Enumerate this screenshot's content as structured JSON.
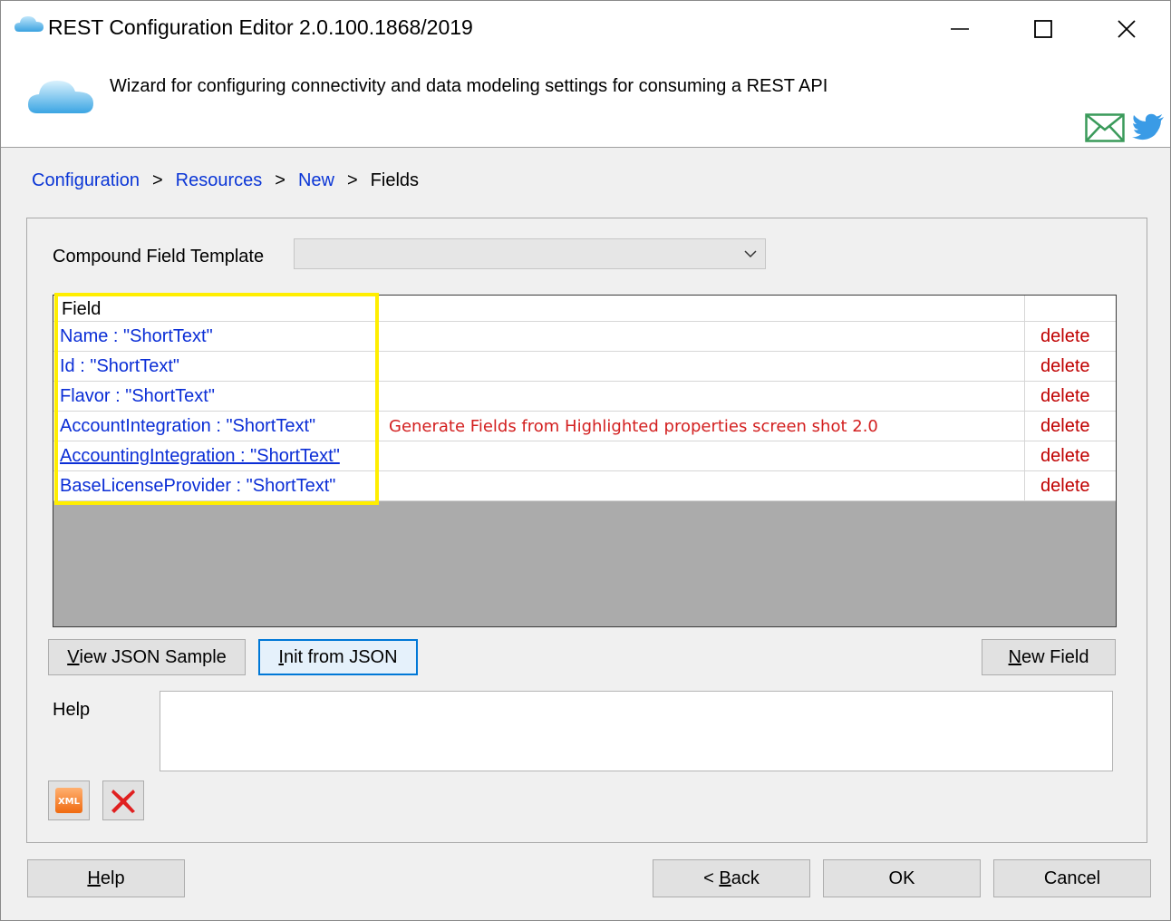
{
  "window": {
    "title": "REST Configuration Editor 2.0.100.1868/2019"
  },
  "header": {
    "description": "Wizard for configuring connectivity and data modeling settings for consuming a REST API"
  },
  "breadcrumb": {
    "items": [
      "Configuration",
      "Resources",
      "New"
    ],
    "current": "Fields",
    "separator": ">"
  },
  "compound_field_template": {
    "label": "Compound Field Template",
    "selected": ""
  },
  "grid": {
    "column_header": "Field",
    "rows": [
      {
        "name": "Name : \"ShortText\"",
        "action": "delete"
      },
      {
        "name": "Id : \"ShortText\"",
        "action": "delete"
      },
      {
        "name": "Flavor : \"ShortText\"",
        "action": "delete"
      },
      {
        "name": "AccountIntegration : \"ShortText\"",
        "action": "delete"
      },
      {
        "name": "AccountingIntegration : \"ShortText\"",
        "action": "delete"
      },
      {
        "name": "BaseLicenseProvider : \"ShortText\"",
        "action": "delete"
      }
    ],
    "annotation": "Generate Fields from Highlighted properties screen shot 2.0",
    "highlight_color": "#ffee00"
  },
  "buttons": {
    "view_json_sample": {
      "mnemonic": "V",
      "rest": "iew JSON Sample"
    },
    "init_from_json": {
      "mnemonic": "I",
      "rest": "nit from JSON"
    },
    "new_field": {
      "mnemonic": "N",
      "rest": "ew Field"
    },
    "help": {
      "mnemonic": "H",
      "rest": "elp"
    },
    "back": {
      "prefix": "< ",
      "mnemonic": "B",
      "rest": "ack"
    },
    "ok": "OK",
    "cancel": "Cancel"
  },
  "help_section": {
    "label": "Help",
    "content": ""
  },
  "icons": {
    "xml_icon_label": "XML",
    "app": "cloud-icon",
    "mail": "mail-icon",
    "twitter": "twitter-icon",
    "delete": "red-x-icon"
  },
  "colors": {
    "link": "#0b36d6",
    "delete": "#c00000",
    "annotation": "#d32020",
    "focus": "#0078d7"
  }
}
